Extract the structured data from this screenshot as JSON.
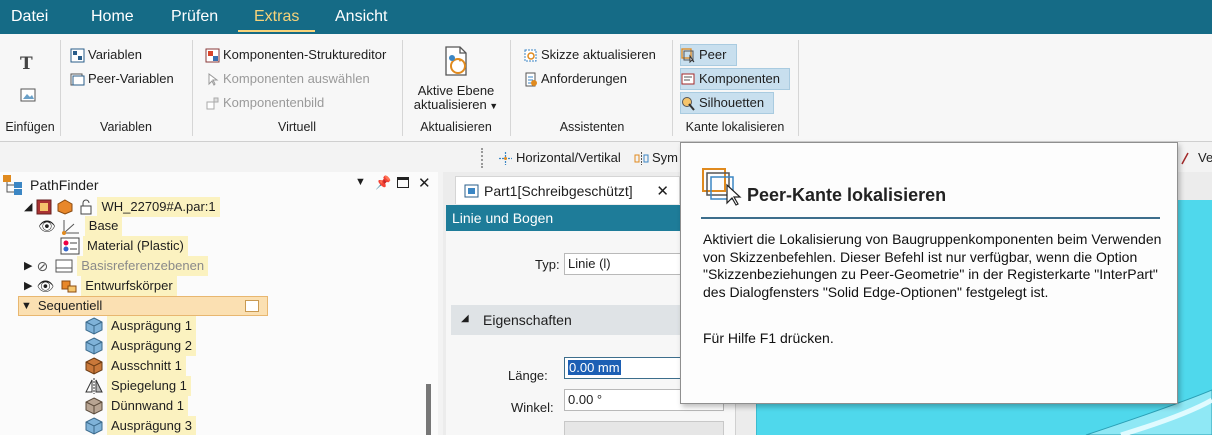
{
  "menubar": {
    "tabs": [
      {
        "label": "Datei",
        "active": false
      },
      {
        "label": "Home",
        "active": false
      },
      {
        "label": "Prüfen",
        "active": false
      },
      {
        "label": "Extras",
        "active": true
      },
      {
        "label": "Ansicht",
        "active": false
      }
    ]
  },
  "ribbon": {
    "groups": {
      "einfuegen": "Einfügen",
      "variablen": "Variablen",
      "virtuell": "Virtuell",
      "aktualisieren": "Aktualisieren",
      "assistenten": "Assistenten",
      "kante": "Kante lokalisieren"
    },
    "variablen": {
      "variablen": "Variablen",
      "peer_variablen": "Peer-Variablen"
    },
    "virtuell": {
      "strukturEditor": "Komponenten-Strukturеditor",
      "auswaehlen": "Komponenten auswählen",
      "bild": "Komponentenbild"
    },
    "aktive_ebene": {
      "line1": "Aktive Ebene",
      "line2": "aktualisieren"
    },
    "assistenten": {
      "skizze": "Skizze aktualisieren",
      "anforderungen": "Anforderungen"
    },
    "kante": {
      "peer": "Peer",
      "komponenten": "Komponenten",
      "silhouetten": "Silhouetten"
    }
  },
  "strip": {
    "horizontal": "Horizontal/Vertikal",
    "sym": "Sym",
    "ve": "Ve"
  },
  "pathfinder": {
    "title": "PathFinder",
    "items": {
      "root": "WH_22709#A.par:1",
      "base": "Base",
      "material": "Material (Plastic)",
      "basisref": "Basisreferenzebenen",
      "entwurf": "Entwurfskörper",
      "sequentiell": "Sequentiell",
      "f1": "Ausprägung 1",
      "f2": "Ausprägung 2",
      "f3": "Ausschnitt 1",
      "f4": "Spiegelung 1",
      "f5": "Dünnwand 1",
      "f6": "Ausprägung 3"
    }
  },
  "doc": {
    "tab_label": "Part1[Schreibgeschützt]",
    "panel_title": "Linie und Bogen",
    "typ_label": "Typ:",
    "typ_value": "Linie (l)",
    "section": "Eigenschaften",
    "laenge_label": "Länge:",
    "laenge_value": "0.00 mm",
    "winkel_label": "Winkel:",
    "winkel_value": "0.00 °"
  },
  "tooltip": {
    "title": "Peer-Kante lokalisieren",
    "description": "Aktiviert die Lokalisierung von Baugruppenkomponenten beim Verwenden von Skizzenbefehlen. Dieser Befehl ist nur verfügbar, wenn die Option \"Skizzenbeziehungen zu Peer-Geometrie\" in der Registerkarte \"InterPart\" des Dialogfensters \"Solid Edge-Optionen\" festgelegt ist.",
    "help": "Für Hilfe F1 drücken."
  },
  "colors": {
    "menubar": "#156b86",
    "active_tab": "#f7d37a",
    "panel_header": "#1e7c99",
    "viewport": "#4fd8ec",
    "tree_highlight": "#fbf2c0"
  }
}
